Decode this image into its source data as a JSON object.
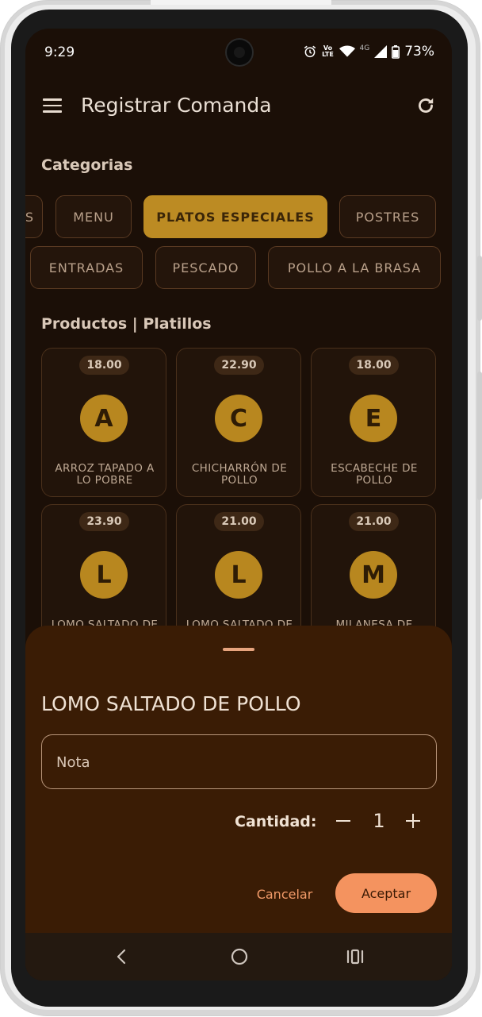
{
  "status_bar": {
    "time": "9:29",
    "volte": "Vo LTE",
    "network": "4G",
    "battery": "73%"
  },
  "app_bar": {
    "title": "Registrar Comanda"
  },
  "categories": {
    "title": "Categorias",
    "row1": [
      {
        "label": "S",
        "active": false
      },
      {
        "label": "MENU",
        "active": false
      },
      {
        "label": "PLATOS ESPECIALES",
        "active": true
      },
      {
        "label": "POSTRES",
        "active": false
      }
    ],
    "row2": [
      {
        "label": "ENTRADAS",
        "active": false
      },
      {
        "label": "PESCADO",
        "active": false
      },
      {
        "label": "POLLO A LA BRASA",
        "active": false
      }
    ]
  },
  "products": {
    "title": "Productos | Platillos",
    "items": [
      {
        "price": "18.00",
        "initial": "A",
        "name": "ARROZ TAPADO A LO POBRE"
      },
      {
        "price": "22.90",
        "initial": "C",
        "name": "CHICHARRÓN DE POLLO"
      },
      {
        "price": "18.00",
        "initial": "E",
        "name": "ESCABECHE DE POLLO"
      },
      {
        "price": "23.90",
        "initial": "L",
        "name": "LOMO SALTADO DE"
      },
      {
        "price": "21.00",
        "initial": "L",
        "name": "LOMO SALTADO DE"
      },
      {
        "price": "21.00",
        "initial": "M",
        "name": "MILANESA DE"
      }
    ]
  },
  "sheet": {
    "title": "LOMO SALTADO DE POLLO",
    "note_placeholder": "Nota",
    "quantity_label": "Cantidad:",
    "quantity_value": "1",
    "cancel_label": "Cancelar",
    "accept_label": "Aceptar"
  },
  "colors": {
    "background": "#1b0f07",
    "accent_chip": "#bc8b23",
    "sheet_background": "#3a1c05",
    "accept_button": "#f4935f"
  }
}
